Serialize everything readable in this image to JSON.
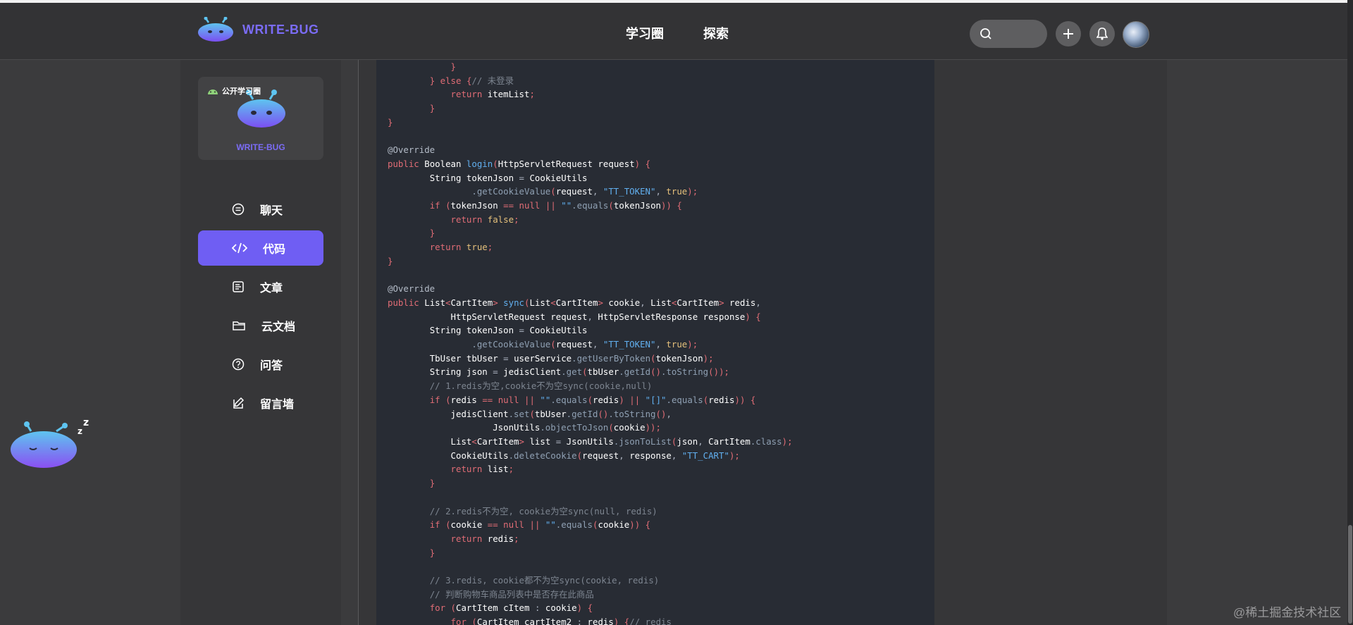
{
  "header": {
    "brand_name": "WRITE-BUG",
    "nav": [
      "学习圈",
      "探索"
    ],
    "icons": {
      "search": "search-icon",
      "add": "plus-icon",
      "notify": "bell-icon",
      "avatar": "user-avatar"
    }
  },
  "sidebar": {
    "group_badge": "公开学习圈",
    "group_logo_text": "WRITE-BUG",
    "items": [
      {
        "label": "聊天",
        "icon": "chat-icon",
        "active": false
      },
      {
        "label": "代码",
        "icon": "code-icon",
        "active": true
      },
      {
        "label": "文章",
        "icon": "article-icon",
        "active": false
      },
      {
        "label": "云文档",
        "icon": "folder-icon",
        "active": false
      },
      {
        "label": "问答",
        "icon": "question-icon",
        "active": false
      },
      {
        "label": "留言墙",
        "icon": "edit-icon",
        "active": false
      }
    ]
  },
  "code": {
    "language": "java",
    "lines": [
      "            }",
      "        } else {// 未登录",
      "            return itemList;",
      "        }",
      "}",
      "",
      "@Override",
      "public Boolean login(HttpServletRequest request) {",
      "        String tokenJson = CookieUtils",
      "                .getCookieValue(request, \"TT_TOKEN\", true);",
      "        if (tokenJson == null || \"\".equals(tokenJson)) {",
      "            return false;",
      "        }",
      "        return true;",
      "}",
      "",
      "@Override",
      "public List<CartItem> sync(List<CartItem> cookie, List<CartItem> redis,",
      "            HttpServletRequest request, HttpServletResponse response) {",
      "        String tokenJson = CookieUtils",
      "                .getCookieValue(request, \"TT_TOKEN\", true);",
      "        TbUser tbUser = userService.getUserByToken(tokenJson);",
      "        String json = jedisClient.get(tbUser.getId().toString());",
      "        // 1.redis为空,cookie不为空sync(cookie,null)",
      "        if (redis == null || \"\".equals(redis) || \"[]\".equals(redis)) {",
      "            jedisClient.set(tbUser.getId().toString(),",
      "                    JsonUtils.objectToJson(cookie));",
      "            List<CartItem> list = JsonUtils.jsonToList(json, CartItem.class);",
      "            CookieUtils.deleteCookie(request, response, \"TT_CART\");",
      "            return list;",
      "        }",
      "",
      "        // 2.redis不为空, cookie为空sync(null, redis)",
      "        if (cookie == null || \"\".equals(cookie)) {",
      "            return redis;",
      "        }",
      "",
      "        // 3.redis, cookie都不为空sync(cookie, redis)",
      "        // 判断购物车商品列表中是否存在此商品",
      "        for (CartItem cItem : cookie) {",
      "            for (CartItem cartItem2 : redis) {// redis"
    ]
  },
  "watermark": "@稀土掘金技术社区"
}
